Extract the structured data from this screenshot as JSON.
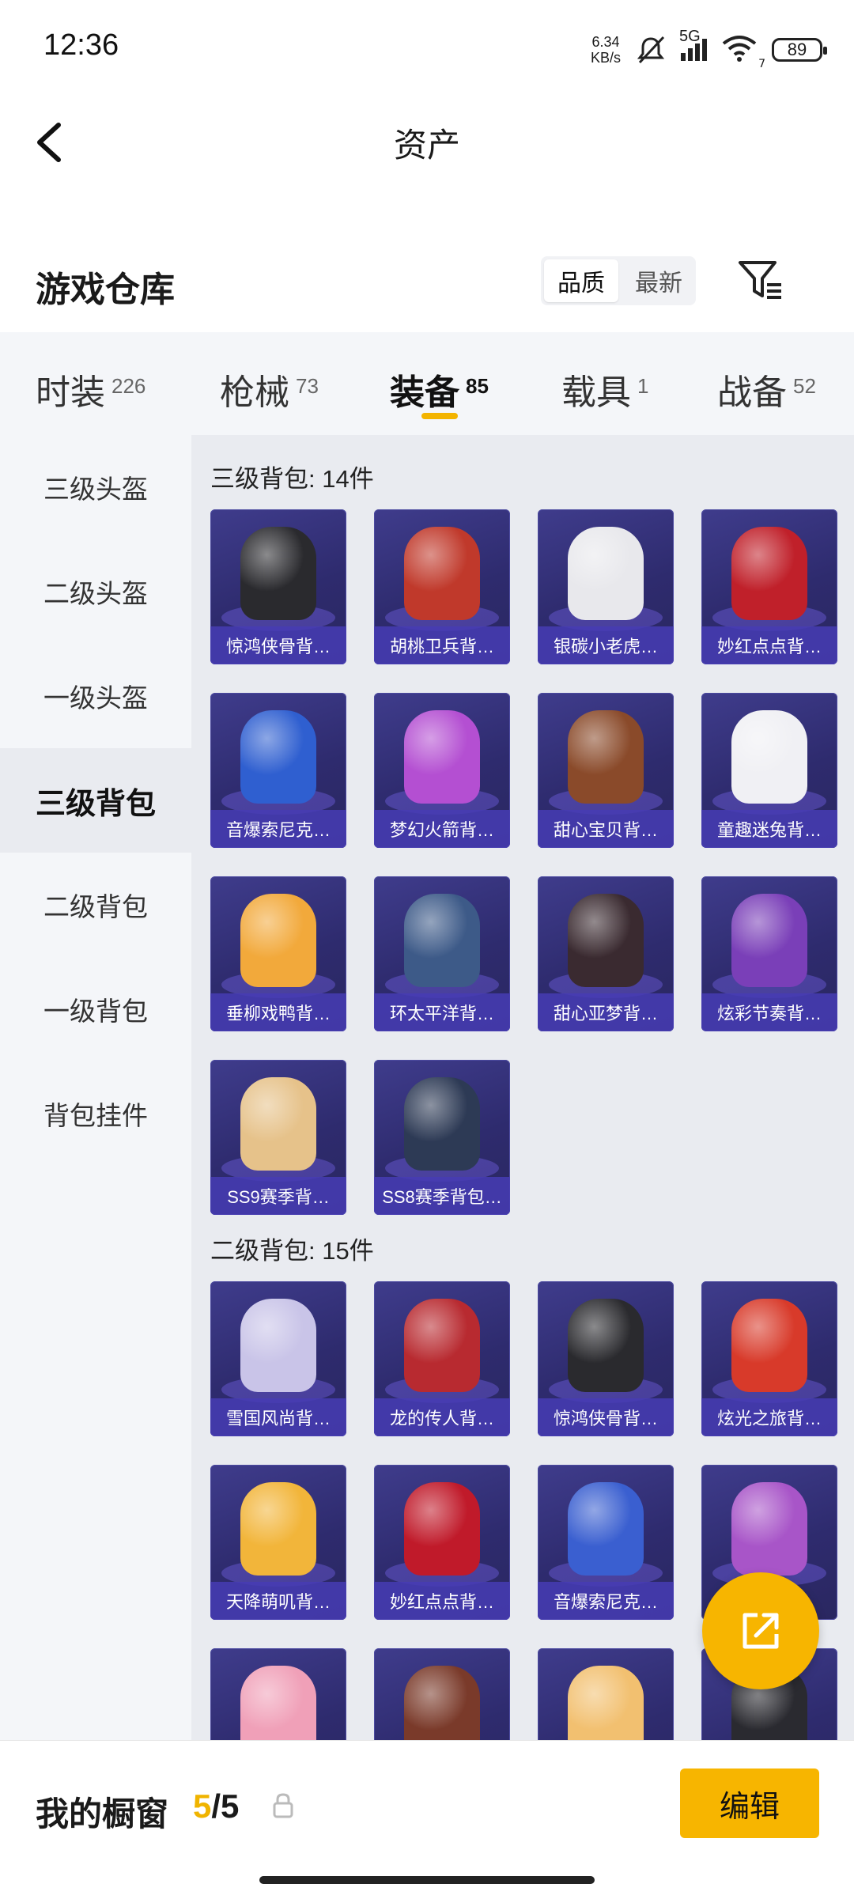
{
  "status": {
    "time": "12:36",
    "net_speed_value": "6.34",
    "net_speed_unit": "KB/s",
    "signal": "5G",
    "wifi_sub": "7",
    "battery": "89"
  },
  "header": {
    "title": "资产"
  },
  "warehouse": {
    "title": "游戏仓库",
    "sort": [
      "品质",
      "最新"
    ]
  },
  "tabs": [
    {
      "label": "时装",
      "count": "226"
    },
    {
      "label": "枪械",
      "count": "73"
    },
    {
      "label": "装备",
      "count": "85"
    },
    {
      "label": "载具",
      "count": "1"
    },
    {
      "label": "战备",
      "count": "52"
    }
  ],
  "sidebar": [
    "三级头盔",
    "二级头盔",
    "一级头盔",
    "三级背包",
    "二级背包",
    "一级背包",
    "背包挂件"
  ],
  "sections": [
    {
      "title": "三级背包: 14件",
      "items": [
        "惊鸿侠骨背…",
        "胡桃卫兵背…",
        "银碳小老虎…",
        "妙红点点背…",
        "音爆索尼克…",
        "梦幻火箭背…",
        "甜心宝贝背…",
        "童趣迷兔背…",
        "垂柳戏鸭背…",
        "环太平洋背…",
        "甜心亚梦背…",
        "炫彩节奏背…",
        "SS9赛季背…",
        "SS8赛季背包…"
      ]
    },
    {
      "title": "二级背包: 15件",
      "items": [
        "雪国风尚背…",
        "龙的传人背…",
        "惊鸿侠骨背…",
        "炫光之旅背…",
        "天降萌叽背…",
        "妙红点点背…",
        "音爆索尼克…",
        "",
        "",
        "",
        "",
        ""
      ]
    }
  ],
  "item_colors": [
    "#2a2a2e",
    "#c0392b",
    "#e8e8ec",
    "#c0202a",
    "#2f5fd0",
    "#b44fd2",
    "#8a4a2a",
    "#f0f0f4",
    "#f2a93b",
    "#3d5a88",
    "#3a2a30",
    "#7a3fb8",
    "#e6c28a",
    "#2d3a55",
    "#c9c4e8",
    "#b82a30",
    "#2a2a2e",
    "#d83a2a",
    "#f2b53a",
    "#c01a2a",
    "#3a5fd0",
    "#a855c8",
    "#f0a0b8",
    "#7a3a2a",
    "#f2c070",
    "#2a2a30"
  ],
  "bottom": {
    "label": "我的橱窗",
    "current": "5",
    "total": "/5",
    "edit": "编辑"
  }
}
